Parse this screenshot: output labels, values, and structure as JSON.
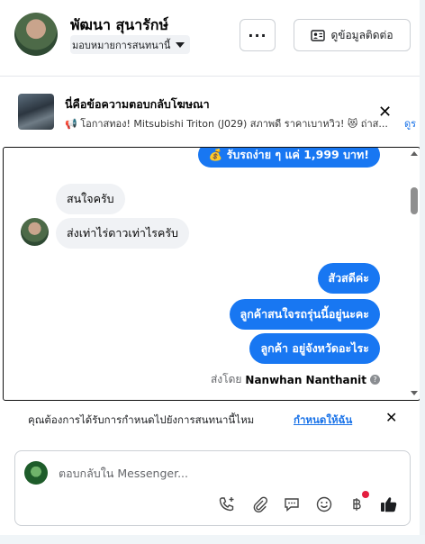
{
  "header": {
    "name": "พัฒนา สุนารักษ์",
    "assign_label": "มอบหมายการสนทนานี้",
    "more_label": "···",
    "contact_label": "ดูข้อมูลติดต่อ"
  },
  "ad": {
    "title": "นี่คือข้อความตอบกลับโฆษณา",
    "line": "📢 โอกาสทอง! Mitsubishi Triton (J029) สภาพดี ราคาเบาหวิว! 😻 ถ่าส...",
    "link": "ดูร",
    "close": "✕"
  },
  "messages": {
    "partial_out": "💰 รับรถง่าย ๆ แค่ 1,999 บาท!",
    "in1": "สนใจครับ",
    "in2": "ส่งเท่าไร่ดาวเท่าไรครับ",
    "out1": "สัวสดีค่ะ",
    "out2": "ลูกค้าสนใจรถรุ่นนี้อยู่นะคะ",
    "out3": "ลูกค้า อยู่จังหวัดอะไระ",
    "sent_by_prefix": "ส่งโดย",
    "sent_by_name": "Nanwhan Nanthanit",
    "info_icon": "?"
  },
  "assign_prompt": {
    "question": "คุณต้องการได้รับการกำหนดไปยังการสนทนานี้ไหม",
    "link": "กำหนดให้ฉัน",
    "close": "✕"
  },
  "composer": {
    "placeholder": "ตอบกลับใน Messenger..."
  },
  "icons": [
    "ellipsis-icon",
    "contact-card-icon",
    "close-icon",
    "info-icon",
    "call-add-icon",
    "attachment-icon",
    "chat-bubble-icon",
    "emoji-icon",
    "baht-payment-icon",
    "thumbs-up-icon"
  ],
  "colors": {
    "accent": "#1877f2",
    "link": "#1a73e8",
    "notification": "#e41e3f"
  }
}
